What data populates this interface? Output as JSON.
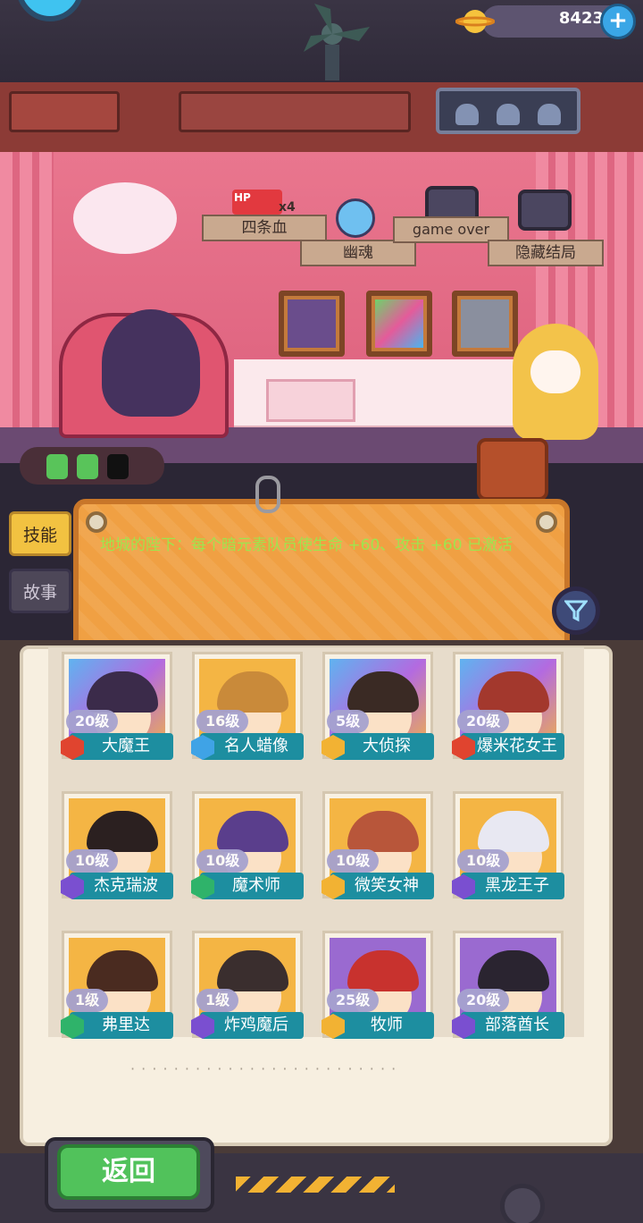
{
  "currency": {
    "amount": "8423",
    "add_label": "+"
  },
  "room_signs": {
    "four_hp": "四条血",
    "hp_tag": "HP",
    "hp_mult": "x4",
    "ghost": "幽魂",
    "game_over": "game over",
    "hidden_ending": "隐藏结局"
  },
  "tabs": {
    "skill": "技能",
    "story": "故事"
  },
  "skill_description": "地城的陛下：每个暗元素队员使生命 +60、攻击 +60 已激活",
  "filter_icon": "filter-icon",
  "roster": [
    {
      "level": "20级",
      "name": "大魔王",
      "element": "fire",
      "portrait": "rainbow"
    },
    {
      "level": "16级",
      "name": "名人蜡像",
      "element": "water",
      "portrait": "gold"
    },
    {
      "level": "5级",
      "name": "大侦探",
      "element": "light",
      "portrait": "rainbow"
    },
    {
      "level": "20级",
      "name": "爆米花女王",
      "element": "fire",
      "portrait": "rainbow"
    },
    {
      "level": "10级",
      "name": "杰克瑞波",
      "element": "dark",
      "portrait": "gold"
    },
    {
      "level": "10级",
      "name": "魔术师",
      "element": "wood",
      "portrait": "gold"
    },
    {
      "level": "10级",
      "name": "微笑女神",
      "element": "light",
      "portrait": "gold"
    },
    {
      "level": "10级",
      "name": "黑龙王子",
      "element": "dark",
      "portrait": "gold"
    },
    {
      "level": "1级",
      "name": "弗里达",
      "element": "wood",
      "portrait": "gold"
    },
    {
      "level": "1级",
      "name": "炸鸡魔后",
      "element": "dark",
      "portrait": "gold"
    },
    {
      "level": "25级",
      "name": "牧师",
      "element": "light",
      "portrait": "purple"
    },
    {
      "level": "20级",
      "name": "部落酋长",
      "element": "dark",
      "portrait": "purple"
    }
  ],
  "element_colors": {
    "fire": "#e0442f",
    "water": "#3fa3e6",
    "light": "#f2b233",
    "dark": "#7a4fd0",
    "wood": "#2fb36a"
  },
  "back_button": "返回"
}
